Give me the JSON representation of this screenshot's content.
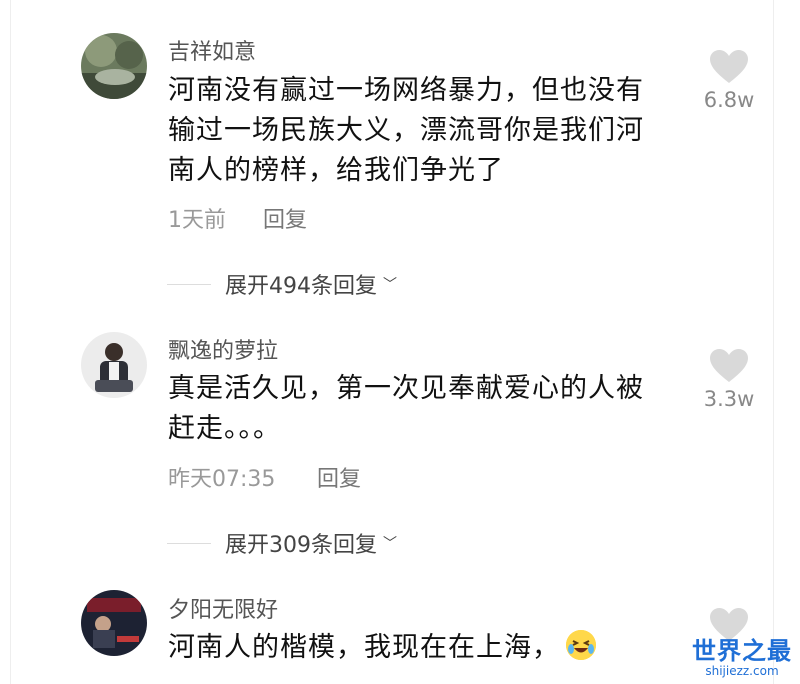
{
  "comments": [
    {
      "username": "吉祥如意",
      "text_lines": [
        "河南没有赢过一场网络暴力，但也没有",
        "输过一场民族大义，漂流哥你是我们河",
        "南人的榜样，给我们争光了"
      ],
      "time": "1天前",
      "reply_label": "回复",
      "likes": "6.8w",
      "expand_label": "展开494条回复"
    },
    {
      "username": "飘逸的萝拉",
      "text_lines": [
        "真是活久见，第一次见奉献爱心的人被",
        "赶走。。。"
      ],
      "time": "昨天07:35",
      "reply_label": "回复",
      "likes": "3.3w",
      "expand_label": "展开309条回复"
    },
    {
      "username": "夕阳无限好",
      "text_lines": [
        "河南人的楷模，我现在在上海，"
      ],
      "emoji": "laughing-crying-emoji"
    }
  ],
  "watermark": {
    "title": "世界之最",
    "subtitle": "shijiezz.com"
  },
  "colors": {
    "heart": "#d9d9d9",
    "watermark": "#1f6fd6"
  }
}
